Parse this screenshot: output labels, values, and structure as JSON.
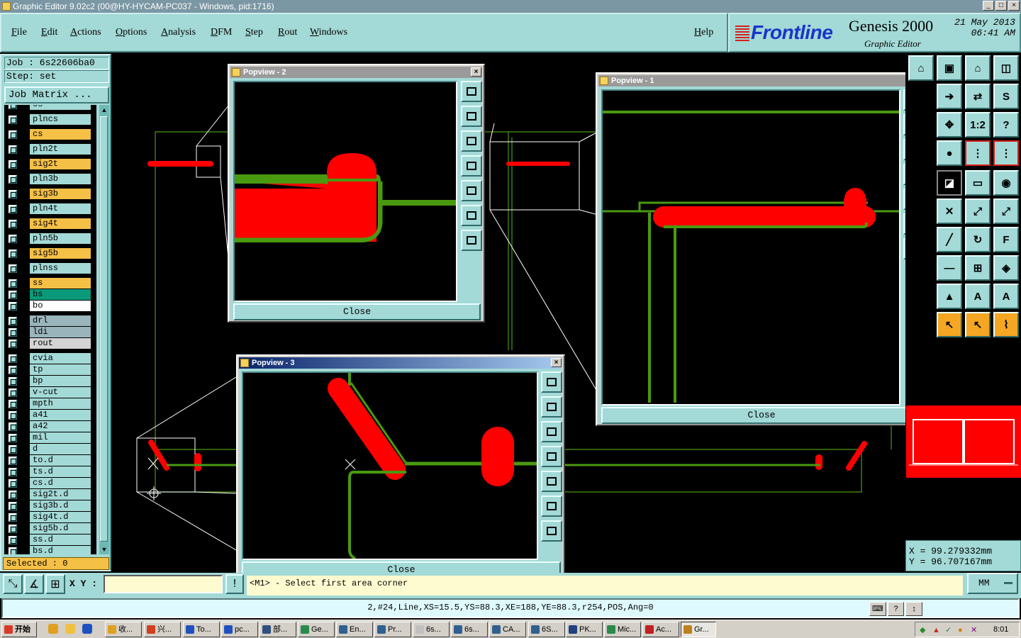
{
  "window": {
    "title": "Graphic Editor 9.02c2 (00@HY-HYCAM-PC037 - Windows, pid:1716)",
    "min": "_",
    "max": "□",
    "close": "×"
  },
  "menu": {
    "file": "File",
    "edit": "Edit",
    "actions": "Actions",
    "options": "Options",
    "analysis": "Analysis",
    "dfm": "DFM",
    "step": "Step",
    "rout": "Rout",
    "windows": "Windows",
    "help": "Help"
  },
  "brand": {
    "logo": "Frontline",
    "product": "Genesis 2000",
    "subtitle": "Graphic Editor",
    "date": "21 May 2013",
    "time": "06:41 AM"
  },
  "job": {
    "job_line": "Job : 6s22606ba0",
    "step_line": "Step: set",
    "job_matrix": "Job Matrix ...",
    "selected": "Selected : 0"
  },
  "layers": [
    {
      "name": "cs",
      "color": "#a3d9d6"
    },
    {
      "name": "plncs",
      "color": "#a3d9d6"
    },
    {
      "name": "cs",
      "color": "#f5c046"
    },
    {
      "name": "pln2t",
      "color": "#a3d9d6"
    },
    {
      "name": "sig2t",
      "color": "#f5c046"
    },
    {
      "name": "pln3b",
      "color": "#a3d9d6"
    },
    {
      "name": "sig3b",
      "color": "#f5c046"
    },
    {
      "name": "pln4t",
      "color": "#a3d9d6"
    },
    {
      "name": "sig4t",
      "color": "#f5c046"
    },
    {
      "name": "pln5b",
      "color": "#a3d9d6"
    },
    {
      "name": "sig5b",
      "color": "#f5c046"
    },
    {
      "name": "plnss",
      "color": "#a3d9d6"
    },
    {
      "name": "ss",
      "color": "#f5c046"
    },
    {
      "name": "bs",
      "color": "#0a9a7a"
    },
    {
      "name": "bo",
      "color": "#ffffff"
    },
    {
      "name": "drl",
      "color": "#9ab4bc"
    },
    {
      "name": "ldi",
      "color": "#9ab4bc"
    },
    {
      "name": "rout",
      "color": "#d4d4d4"
    },
    {
      "name": "cvia",
      "color": "#a3d9d6"
    },
    {
      "name": "tp",
      "color": "#a3d9d6"
    },
    {
      "name": "bp",
      "color": "#a3d9d6"
    },
    {
      "name": "v-cut",
      "color": "#a3d9d6"
    },
    {
      "name": "mpth",
      "color": "#a3d9d6"
    },
    {
      "name": "a41",
      "color": "#a3d9d6"
    },
    {
      "name": "a42",
      "color": "#a3d9d6"
    },
    {
      "name": "mil",
      "color": "#a3d9d6"
    },
    {
      "name": "d",
      "color": "#a3d9d6"
    },
    {
      "name": "to.d",
      "color": "#a3d9d6"
    },
    {
      "name": "ts.d",
      "color": "#a3d9d6"
    },
    {
      "name": "cs.d",
      "color": "#a3d9d6"
    },
    {
      "name": "sig2t.d",
      "color": "#a3d9d6"
    },
    {
      "name": "sig3b.d",
      "color": "#a3d9d6"
    },
    {
      "name": "sig4t.d",
      "color": "#a3d9d6"
    },
    {
      "name": "sig5b.d",
      "color": "#a3d9d6"
    },
    {
      "name": "ss.d",
      "color": "#a3d9d6"
    },
    {
      "name": "bs.d",
      "color": "#a3d9d6"
    }
  ],
  "popviews": {
    "p1": {
      "title": "Popview - 1",
      "close": "Close"
    },
    "p2": {
      "title": "Popview - 2",
      "close": "Close"
    },
    "p3": {
      "title": "Popview - 3",
      "close": "Close"
    }
  },
  "coords": {
    "x": "X  =  99.279332mm",
    "y": "Y  =  96.707167mm"
  },
  "units": "MM",
  "bottom": {
    "xy_label": "X Y :",
    "xy_value": "",
    "prompt": "<M1> - Select first area corner",
    "status": "2,#24,Line,XS=15.5,YS=88.3,XE=188,YE=88.3,r254,POS,Ang=0"
  },
  "taskbar": {
    "start": "开始",
    "items": [
      "收...",
      "兴...",
      "To...",
      "pc...",
      "部...",
      "Ge...",
      "En...",
      "Pr...",
      "6s...",
      "6s...",
      "CA...",
      "6S...",
      "PK...",
      "Mic...",
      "Ac...",
      "Gr..."
    ],
    "clock": "8:01"
  },
  "colors": {
    "panel": "#a3d9d6",
    "feature_red": "#ff0000",
    "feature_green": "#4a9a10",
    "profile": "#ffffff"
  }
}
